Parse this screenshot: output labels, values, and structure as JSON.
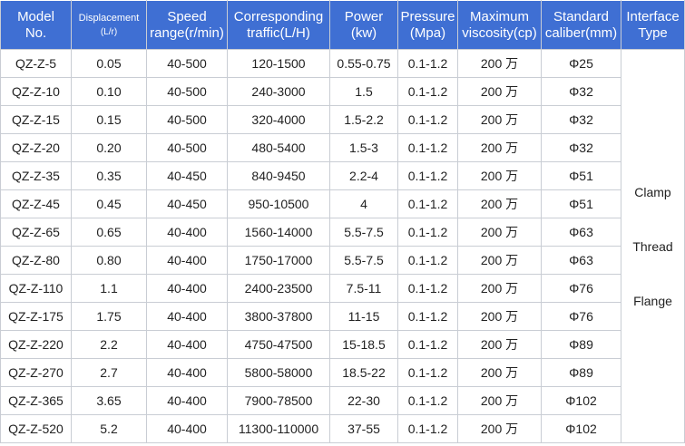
{
  "headers": [
    [
      "Model",
      "No."
    ],
    [
      "Displacement",
      "(L/r)"
    ],
    [
      "Speed",
      "range(r/min)"
    ],
    [
      "Corresponding",
      "traffic(L/H)"
    ],
    [
      "Power",
      "(kw)"
    ],
    [
      "Pressure",
      "(Mpa)"
    ],
    [
      "Maximum",
      "viscosity(cp)"
    ],
    [
      "Standard",
      "caliber(mm)"
    ],
    [
      "Interface",
      "Type"
    ]
  ],
  "rows": [
    [
      "QZ-Z-5",
      "0.05",
      "40-500",
      "120-1500",
      "0.55-0.75",
      "0.1-1.2",
      "200 万",
      "Φ25"
    ],
    [
      "QZ-Z-10",
      "0.10",
      "40-500",
      "240-3000",
      "1.5",
      "0.1-1.2",
      "200 万",
      "Φ32"
    ],
    [
      "QZ-Z-15",
      "0.15",
      "40-500",
      "320-4000",
      "1.5-2.2",
      "0.1-1.2",
      "200 万",
      "Φ32"
    ],
    [
      "QZ-Z-20",
      "0.20",
      "40-500",
      "480-5400",
      "1.5-3",
      "0.1-1.2",
      "200 万",
      "Φ32"
    ],
    [
      "QZ-Z-35",
      "0.35",
      "40-450",
      "840-9450",
      "2.2-4",
      "0.1-1.2",
      "200 万",
      "Φ51"
    ],
    [
      "QZ-Z-45",
      "0.45",
      "40-450",
      "950-10500",
      "4",
      "0.1-1.2",
      "200 万",
      "Φ51"
    ],
    [
      "QZ-Z-65",
      "0.65",
      "40-400",
      "1560-14000",
      "5.5-7.5",
      "0.1-1.2",
      "200 万",
      "Φ63"
    ],
    [
      "QZ-Z-80",
      "0.80",
      "40-400",
      "1750-17000",
      "5.5-7.5",
      "0.1-1.2",
      "200 万",
      "Φ63"
    ],
    [
      "QZ-Z-110",
      "1.1",
      "40-400",
      "2400-23500",
      "7.5-11",
      "0.1-1.2",
      "200 万",
      "Φ76"
    ],
    [
      "QZ-Z-175",
      "1.75",
      "40-400",
      "3800-37800",
      "11-15",
      "0.1-1.2",
      "200 万",
      "Φ76"
    ],
    [
      "QZ-Z-220",
      "2.2",
      "40-400",
      "4750-47500",
      "15-18.5",
      "0.1-1.2",
      "200 万",
      "Φ89"
    ],
    [
      "QZ-Z-270",
      "2.7",
      "40-400",
      "5800-58000",
      "18.5-22",
      "0.1-1.2",
      "200 万",
      "Φ89"
    ],
    [
      "QZ-Z-365",
      "3.65",
      "40-400",
      "7900-78500",
      "22-30",
      "0.1-1.2",
      "200 万",
      "Φ102"
    ],
    [
      "QZ-Z-520",
      "5.2",
      "40-400",
      "11300-110000",
      "37-55",
      "0.1-1.2",
      "200 万",
      "Φ102"
    ]
  ],
  "interface_types": [
    "Clamp",
    "Thread",
    "Flange"
  ],
  "colors": {
    "header_bg": "#3f6fd3",
    "header_text": "#ffffff",
    "grid": "#c9cdd4",
    "cell_text": "#222222"
  }
}
